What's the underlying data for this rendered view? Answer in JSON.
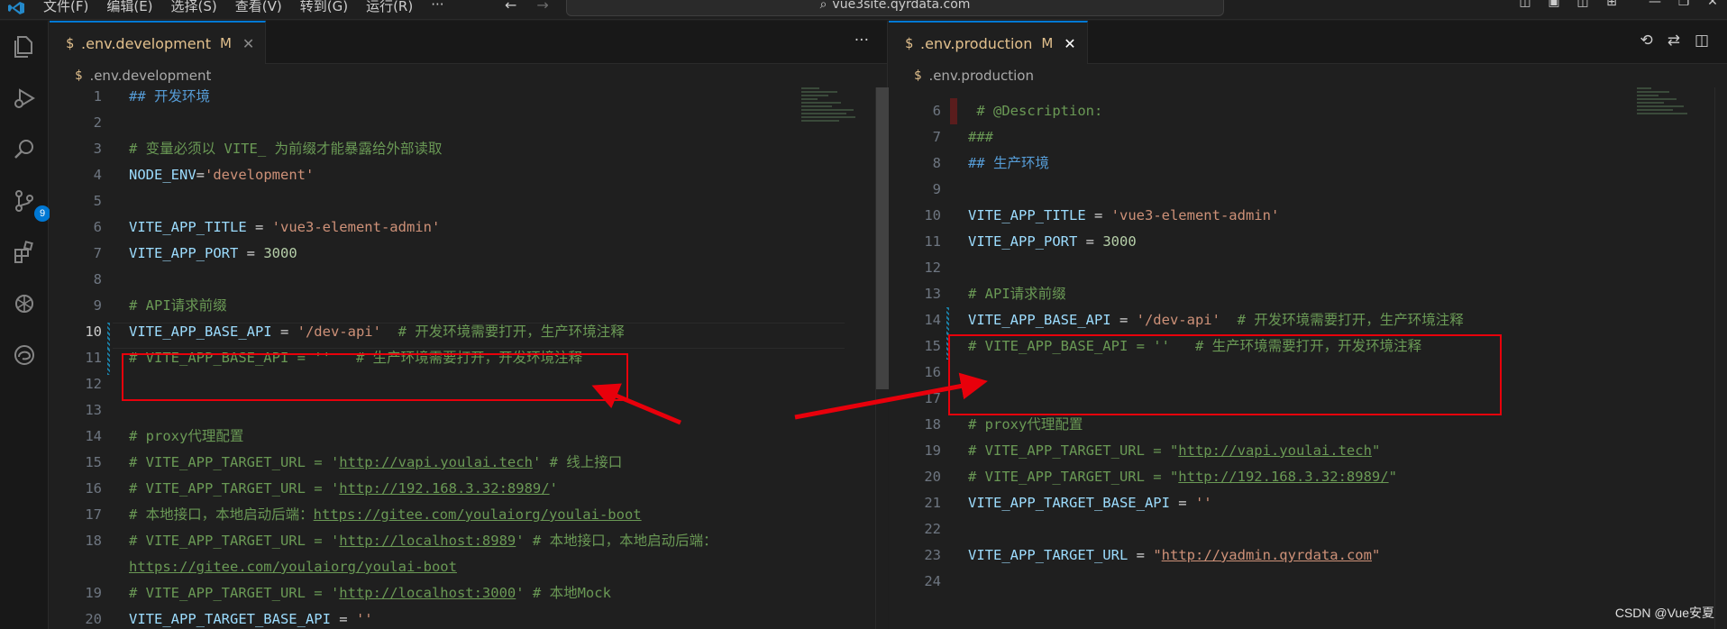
{
  "menu": [
    "文件(F)",
    "编辑(E)",
    "选择(S)",
    "查看(V)",
    "转到(G)",
    "运行(R)",
    "···"
  ],
  "command_center": "vue3site.qyrdata.com",
  "activity": {
    "scm_badge": "9"
  },
  "left": {
    "tab": {
      "name": ".env.development",
      "status": "M",
      "close": "✕"
    },
    "more": "···",
    "breadcrumb": ".env.development",
    "lines": [
      {
        "n": "1",
        "segs": [
          {
            "c": "hd",
            "t": "## 开发环境"
          }
        ]
      },
      {
        "n": "2",
        "segs": []
      },
      {
        "n": "3",
        "segs": [
          {
            "c": "cm",
            "t": "# 变量必须以 VITE_ 为前缀才能暴露给外部读取"
          }
        ]
      },
      {
        "n": "4",
        "segs": [
          {
            "c": "var",
            "t": "NODE_ENV"
          },
          {
            "c": "op",
            "t": "="
          },
          {
            "c": "str",
            "t": "'development'"
          }
        ]
      },
      {
        "n": "5",
        "segs": []
      },
      {
        "n": "6",
        "segs": [
          {
            "c": "var",
            "t": "VITE_APP_TITLE"
          },
          {
            "c": "op",
            "t": " = "
          },
          {
            "c": "str",
            "t": "'vue3-element-admin'"
          }
        ]
      },
      {
        "n": "7",
        "segs": [
          {
            "c": "var",
            "t": "VITE_APP_PORT"
          },
          {
            "c": "op",
            "t": " = "
          },
          {
            "c": "num",
            "t": "3000"
          }
        ]
      },
      {
        "n": "8",
        "segs": []
      },
      {
        "n": "9",
        "segs": [
          {
            "c": "cm",
            "t": "# API请求前缀"
          }
        ]
      },
      {
        "n": "10",
        "segs": [
          {
            "c": "var",
            "t": "VITE_APP_BASE_API"
          },
          {
            "c": "op",
            "t": " = "
          },
          {
            "c": "str",
            "t": "'/dev-api'"
          },
          {
            "c": "op",
            "t": "  "
          },
          {
            "c": "cm",
            "t": "# 开发环境需要打开，生产环境注释"
          }
        ]
      },
      {
        "n": "11",
        "segs": [
          {
            "c": "cm",
            "t": "# VITE_APP_BASE_API = ''   # 生产环境需要打开，开发环境注释"
          }
        ]
      },
      {
        "n": "12",
        "segs": []
      },
      {
        "n": "13",
        "segs": []
      },
      {
        "n": "14",
        "segs": [
          {
            "c": "cm",
            "t": "# proxy代理配置"
          }
        ]
      },
      {
        "n": "15",
        "segs": [
          {
            "c": "cm",
            "t": "# VITE_APP_TARGET_URL = '"
          },
          {
            "c": "cm lnk",
            "t": "http://vapi.youlai.tech"
          },
          {
            "c": "cm",
            "t": "' # 线上接口"
          }
        ]
      },
      {
        "n": "16",
        "segs": [
          {
            "c": "cm",
            "t": "# VITE_APP_TARGET_URL = '"
          },
          {
            "c": "cm lnk",
            "t": "http://192.168.3.32:8989/"
          },
          {
            "c": "cm",
            "t": "'"
          }
        ]
      },
      {
        "n": "17",
        "segs": [
          {
            "c": "cm",
            "t": "# 本地接口，本地启动后端："
          },
          {
            "c": "cm lnk",
            "t": "https://gitee.com/youlaiorg/youlai-boot"
          }
        ]
      },
      {
        "n": "18",
        "segs": [
          {
            "c": "cm",
            "t": "# VITE_APP_TARGET_URL = '"
          },
          {
            "c": "cm lnk",
            "t": "http://localhost:8989"
          },
          {
            "c": "cm",
            "t": "' # 本地接口，本地启动后端："
          }
        ]
      },
      {
        "n": "",
        "segs": [
          {
            "c": "cm lnk",
            "t": "https://gitee.com/youlaiorg/youlai-boot"
          }
        ]
      },
      {
        "n": "19",
        "segs": [
          {
            "c": "cm",
            "t": "# VITE_APP_TARGET_URL = '"
          },
          {
            "c": "cm lnk",
            "t": "http://localhost:3000"
          },
          {
            "c": "cm",
            "t": "' # 本地Mock"
          }
        ]
      },
      {
        "n": "20",
        "segs": [
          {
            "c": "var",
            "t": "VITE_APP_TARGET_BASE_API"
          },
          {
            "c": "op",
            "t": " = "
          },
          {
            "c": "str",
            "t": "''"
          }
        ]
      }
    ]
  },
  "right": {
    "tab": {
      "name": ".env.production",
      "status": "M",
      "close": "✕"
    },
    "breadcrumb": ".env.production",
    "lines": [
      {
        "n": "6",
        "segs": [
          {
            "c": "cm",
            "t": " # @Description:"
          }
        ]
      },
      {
        "n": "7",
        "segs": [
          {
            "c": "cm",
            "t": "###"
          }
        ]
      },
      {
        "n": "8",
        "segs": [
          {
            "c": "hd",
            "t": "## 生产环境"
          }
        ]
      },
      {
        "n": "9",
        "segs": []
      },
      {
        "n": "10",
        "segs": [
          {
            "c": "var",
            "t": "VITE_APP_TITLE"
          },
          {
            "c": "op",
            "t": " = "
          },
          {
            "c": "str",
            "t": "'vue3-element-admin'"
          }
        ]
      },
      {
        "n": "11",
        "segs": [
          {
            "c": "var",
            "t": "VITE_APP_PORT"
          },
          {
            "c": "op",
            "t": " = "
          },
          {
            "c": "num",
            "t": "3000"
          }
        ]
      },
      {
        "n": "12",
        "segs": []
      },
      {
        "n": "13",
        "segs": [
          {
            "c": "cm",
            "t": "# API请求前缀"
          }
        ]
      },
      {
        "n": "14",
        "segs": [
          {
            "c": "var",
            "t": "VITE_APP_BASE_API"
          },
          {
            "c": "op",
            "t": " = "
          },
          {
            "c": "str",
            "t": "'/dev-api'"
          },
          {
            "c": "op",
            "t": "  "
          },
          {
            "c": "cm",
            "t": "# 开发环境需要打开，生产环境注释"
          }
        ]
      },
      {
        "n": "15",
        "segs": [
          {
            "c": "cm",
            "t": "# VITE_APP_BASE_API = ''   # 生产环境需要打开，开发环境注释"
          }
        ]
      },
      {
        "n": "16",
        "segs": []
      },
      {
        "n": "17",
        "segs": []
      },
      {
        "n": "18",
        "segs": [
          {
            "c": "cm",
            "t": "# proxy代理配置"
          }
        ]
      },
      {
        "n": "19",
        "segs": [
          {
            "c": "cm",
            "t": "# VITE_APP_TARGET_URL = \""
          },
          {
            "c": "cm lnk",
            "t": "http://vapi.youlai.tech"
          },
          {
            "c": "cm",
            "t": "\""
          }
        ]
      },
      {
        "n": "20",
        "segs": [
          {
            "c": "cm",
            "t": "# VITE_APP_TARGET_URL = \""
          },
          {
            "c": "cm lnk",
            "t": "http://192.168.3.32:8989/"
          },
          {
            "c": "cm",
            "t": "\""
          }
        ]
      },
      {
        "n": "21",
        "segs": [
          {
            "c": "var",
            "t": "VITE_APP_TARGET_BASE_API"
          },
          {
            "c": "op",
            "t": " = "
          },
          {
            "c": "str",
            "t": "''"
          }
        ]
      },
      {
        "n": "22",
        "segs": []
      },
      {
        "n": "23",
        "segs": [
          {
            "c": "var",
            "t": "VITE_APP_TARGET_URL"
          },
          {
            "c": "op",
            "t": " = "
          },
          {
            "c": "str",
            "t": "\""
          },
          {
            "c": "str lnk",
            "t": "http://yadmin.qyrdata.com"
          },
          {
            "c": "str",
            "t": "\""
          }
        ]
      },
      {
        "n": "24",
        "segs": []
      }
    ]
  },
  "watermark": "CSDN @Vue安夏"
}
